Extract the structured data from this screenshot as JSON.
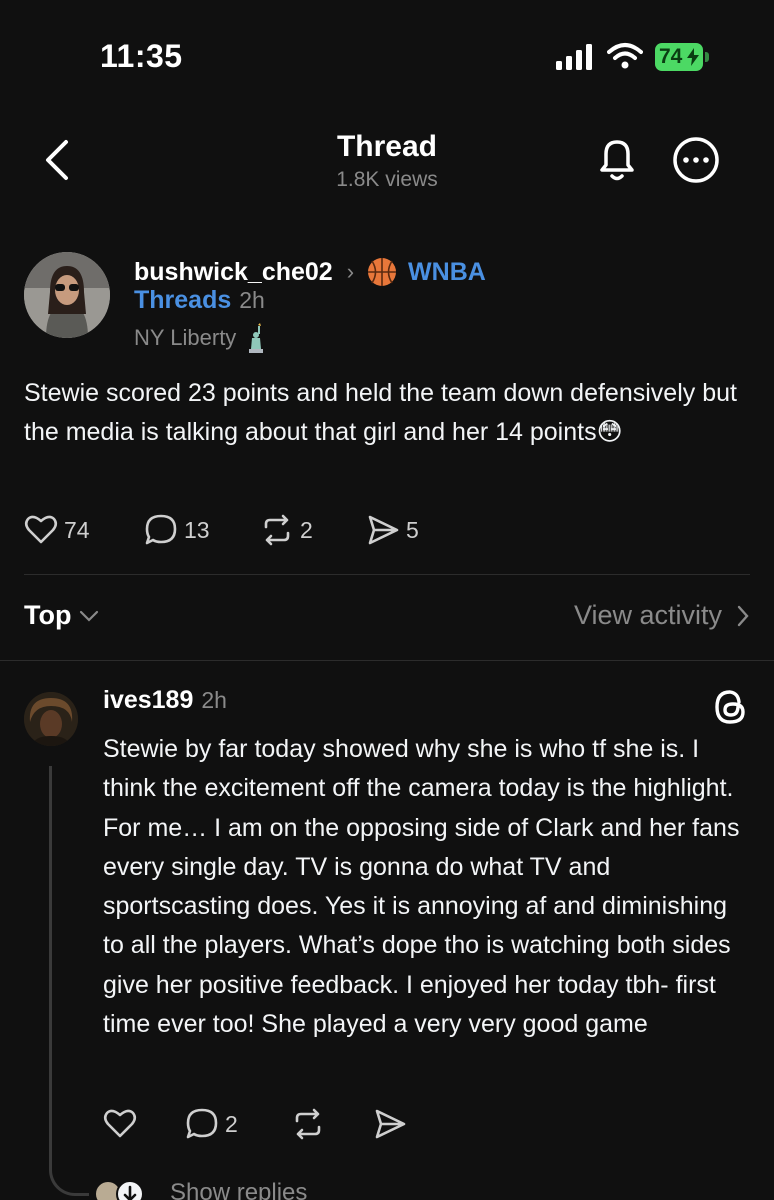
{
  "status_bar": {
    "time": "11:35",
    "battery": "74",
    "icons": [
      "signal-icon",
      "wifi-icon",
      "battery-charging-icon"
    ]
  },
  "header": {
    "title": "Thread",
    "views": "1.8K views",
    "icons": [
      "back-chevron-icon",
      "bell-icon",
      "more-icon"
    ]
  },
  "post": {
    "author": "bushwick_che02",
    "community": "WNBA",
    "community_sub": "Threads",
    "time": "2h",
    "bio": "NY Liberty",
    "body": "Stewie scored 23 points and held the team down defensively but the media is talking about that girl and her 14 points😳",
    "likes": "74",
    "comments": "13",
    "reposts": "2",
    "shares": "5"
  },
  "sort": {
    "label": "Top",
    "view_activity": "View activity"
  },
  "reply": {
    "author": "ives189",
    "time": "2h",
    "body": "Stewie by far today showed why she is who tf she is. I think the excitement off the camera today is the highlight. For me… I am on the opposing side of Clark and her fans every single day. TV is gonna do what TV and sportscasting does. Yes it is annoying af and diminishing to all the players. What’s dope tho is watching both sides give her positive feedback. I enjoyed her today tbh- first time ever too! She played a very very good game",
    "comments": "2",
    "show_replies": "Show replies"
  },
  "colors": {
    "background": "#101010",
    "link_blue": "#4a90e2",
    "muted": "#8a8a8a",
    "battery_green": "#4cd964"
  }
}
